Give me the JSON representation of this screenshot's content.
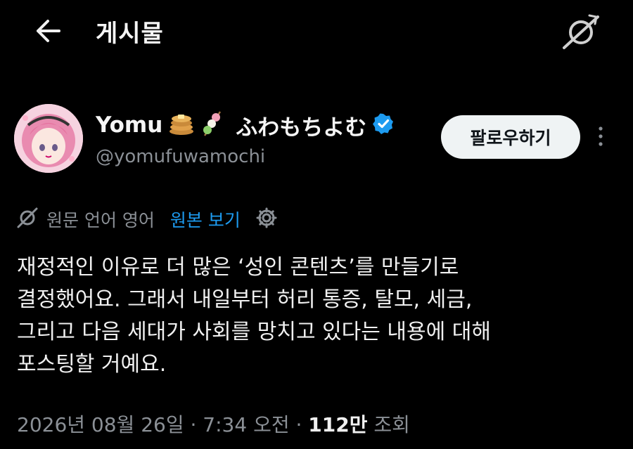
{
  "header": {
    "title": "게시물",
    "back_icon": "arrow-left-icon",
    "translate_icon": "translate-icon"
  },
  "author": {
    "display_name": "Yomu",
    "emojis": [
      "pancakes-emoji",
      "dango-emoji"
    ],
    "jp_name": "ふわもちよむ",
    "verified": true,
    "handle": "@yomufuwamochi",
    "follow_label": "팔로우하기"
  },
  "translation": {
    "info": "원문 언어 영어",
    "show_original": "원본 보기"
  },
  "tweet": {
    "lines": [
      "재정적인 이유로 더 많은 ‘성인 콘텐츠’를 만들기로",
      "결정했어요. 그래서 내일부터 허리 통증, 탈모, 세금,",
      "그리고 다음 세대가 사회를 망치고 있다는 내용에 대해",
      "포스팅할 거예요."
    ]
  },
  "meta": {
    "datetime": "2026년 08월 26일 · 7:34 오전 · ",
    "views_count": "112만",
    "views_label": " 조회"
  },
  "colors": {
    "background": "#000000",
    "accent": "#1d9bf0",
    "text": "#e7e9ea",
    "secondary": "#8b9096"
  }
}
